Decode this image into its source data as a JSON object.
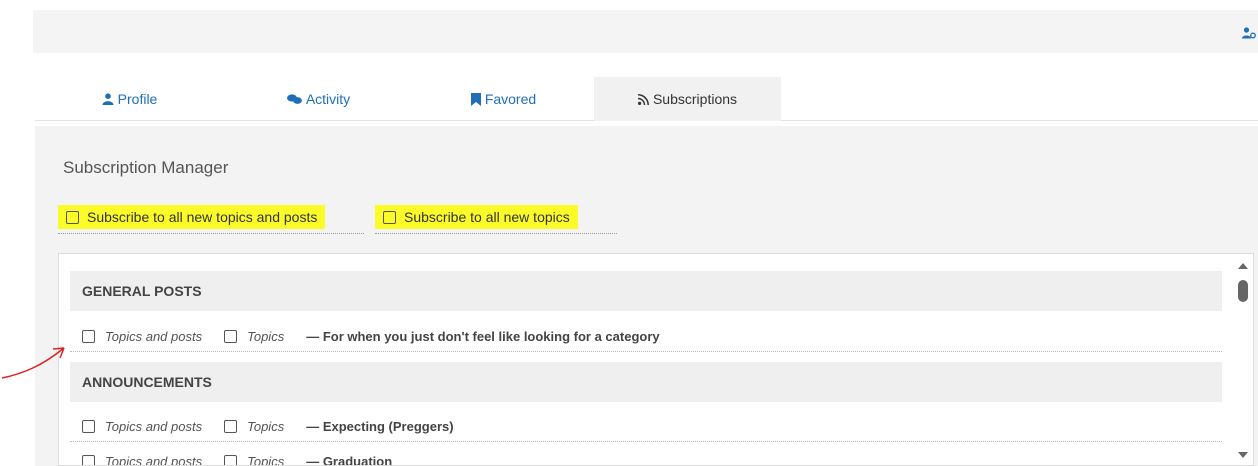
{
  "header": {
    "user_icon": "user-settings-icon"
  },
  "tabs": [
    {
      "label": "Profile",
      "icon": "user-icon",
      "active": false
    },
    {
      "label": "Activity",
      "icon": "comments-icon",
      "active": false
    },
    {
      "label": "Favored",
      "icon": "bookmark-icon",
      "active": false
    },
    {
      "label": "Subscriptions",
      "icon": "rss-icon",
      "active": true
    }
  ],
  "panel": {
    "title": "Subscription Manager",
    "subscribe_all_topics_posts": "Subscribe to all new topics and posts",
    "subscribe_all_topics": "Subscribe to all new topics",
    "highlight_color": "#fbfb2a"
  },
  "categories": [
    {
      "name": "GENERAL POSTS"
    },
    {
      "name": "ANNOUNCEMENTS"
    }
  ],
  "rows": [
    {
      "opt1": "Topics and posts",
      "opt2": "Topics",
      "description": "— For when you just don't feel like looking for a category"
    },
    {
      "opt1": "Topics and posts",
      "opt2": "Topics",
      "description": "— Expecting (Preggers)"
    },
    {
      "opt1": "Topics and posts",
      "opt2": "Topics",
      "description": "— Graduation"
    }
  ],
  "annotation": {
    "arrow_color": "#e02020"
  }
}
